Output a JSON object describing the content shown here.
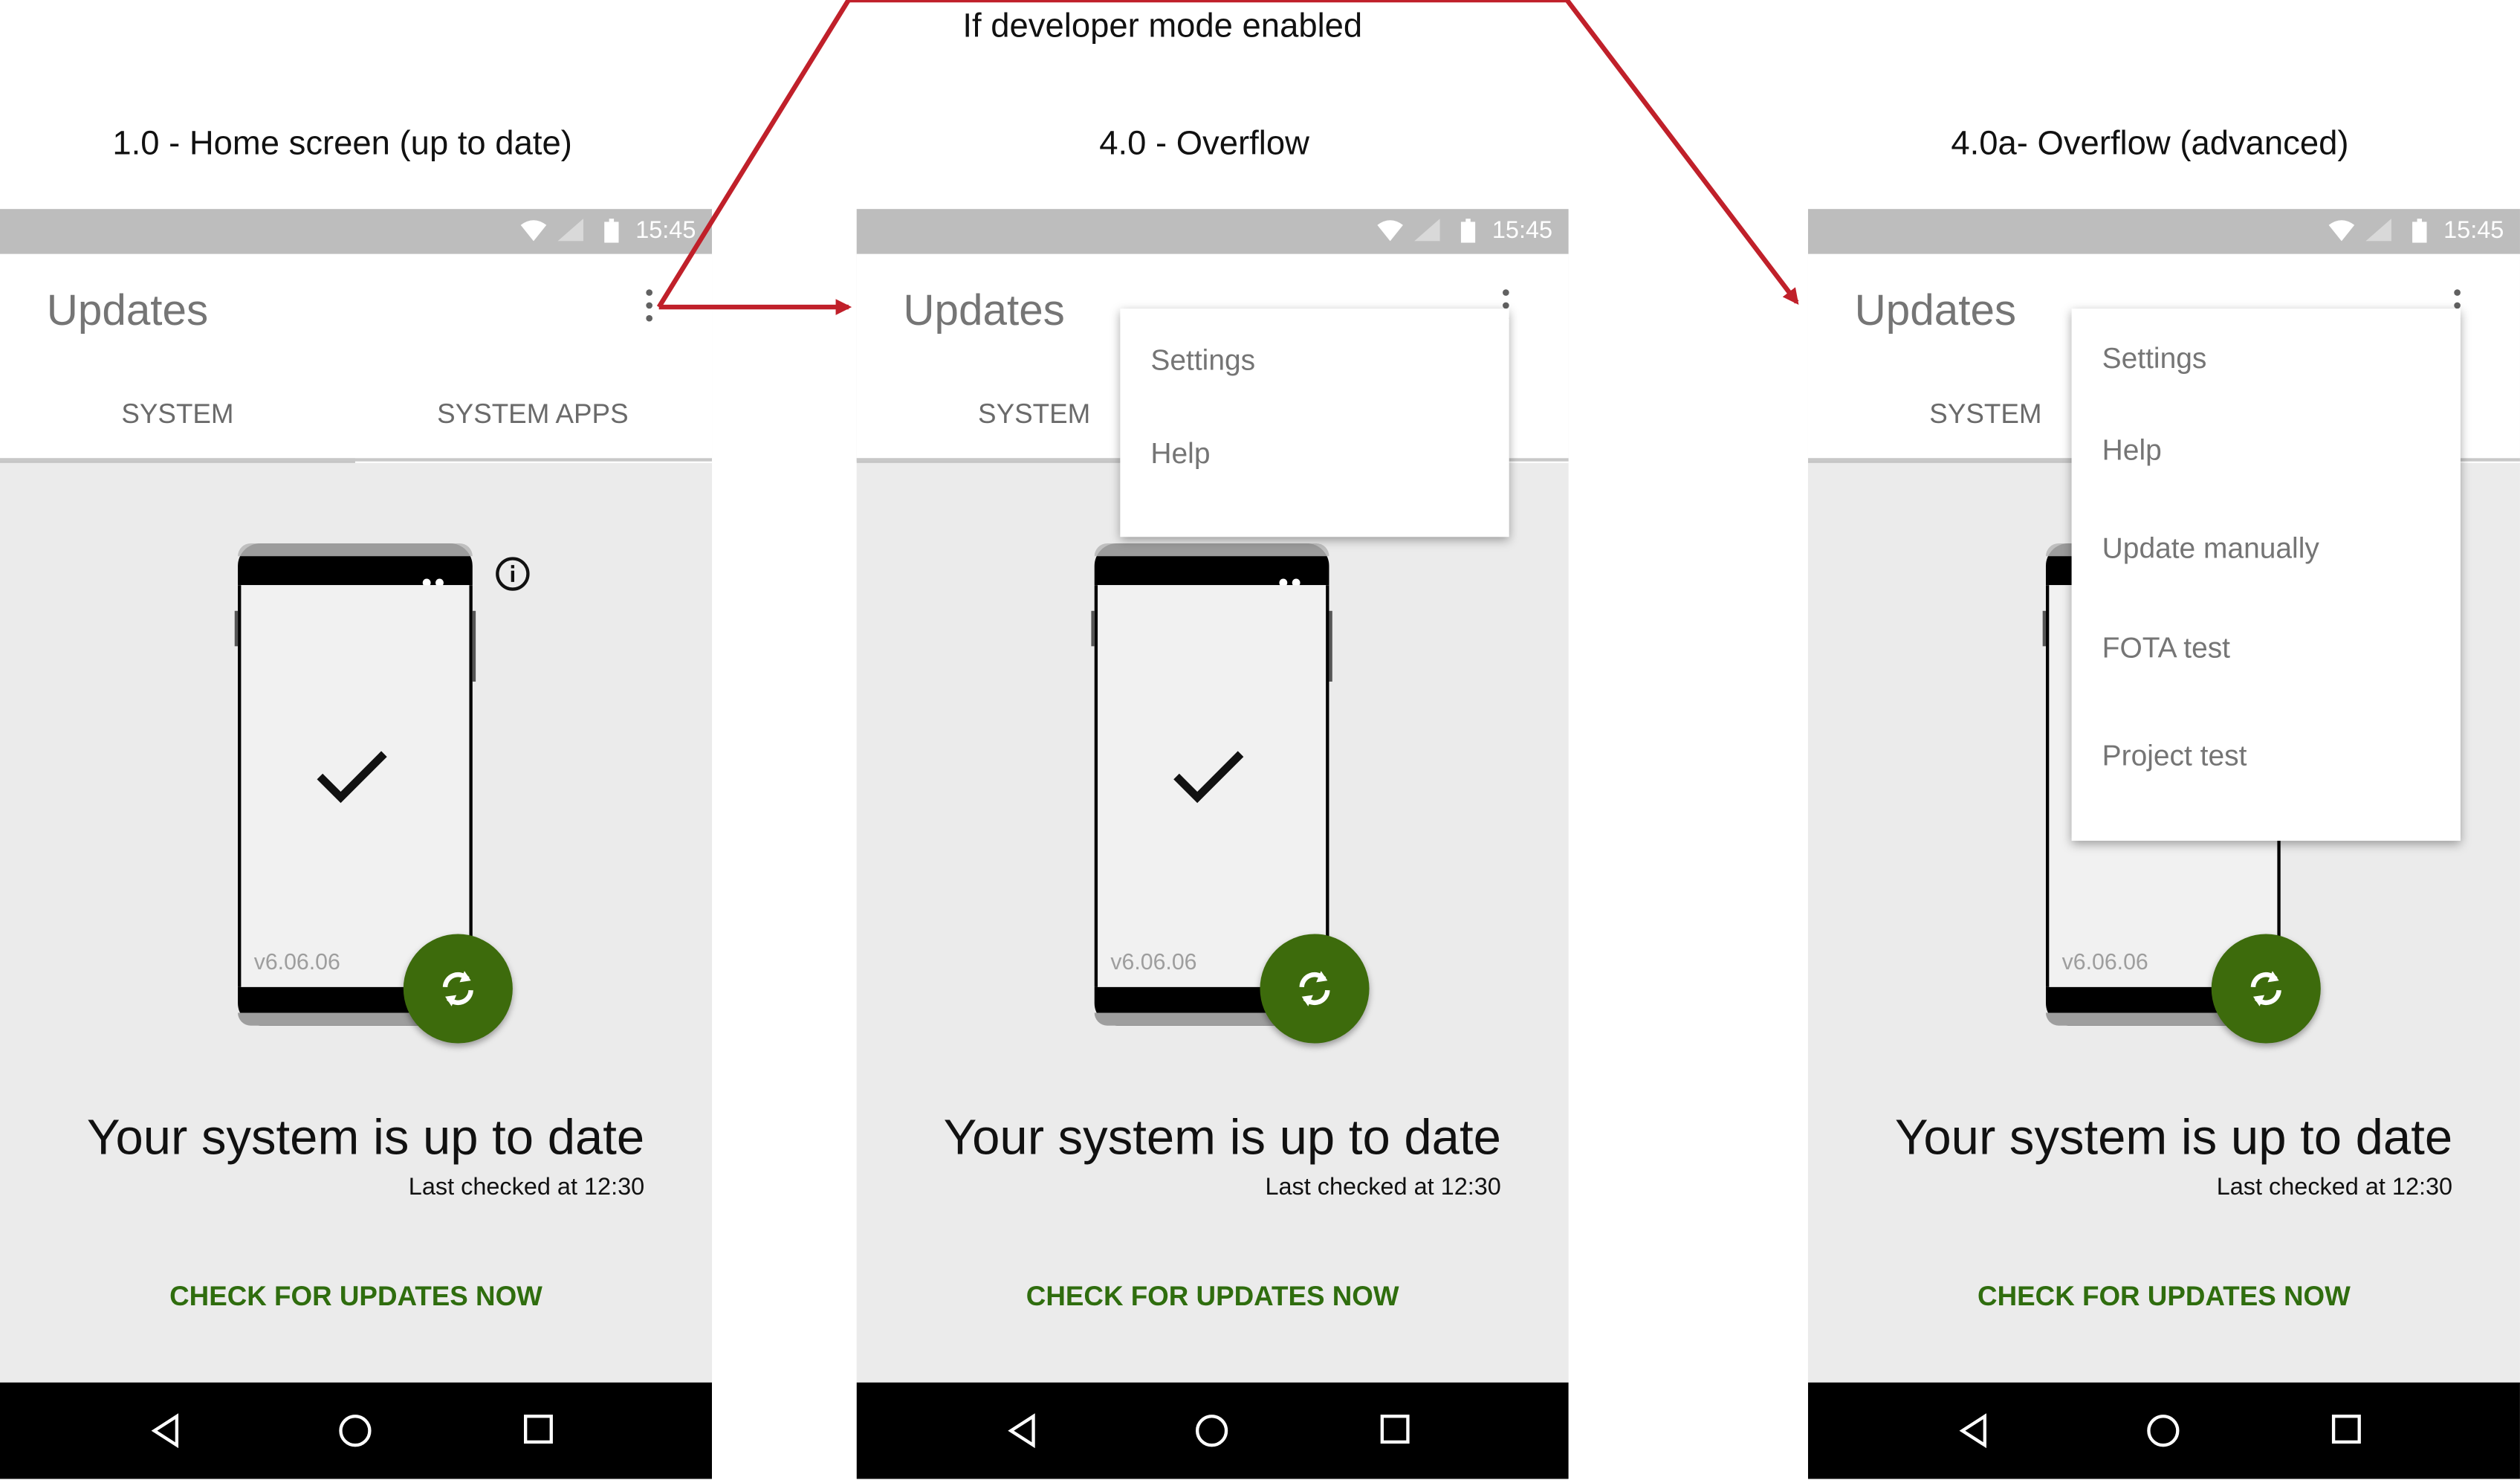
{
  "annotation": "If developer mode enabled",
  "colors": {
    "accent": "#2f6d0e",
    "fab": "#3d6b0c",
    "arrow": "#c0202a",
    "statusbar": "#bdbdbd",
    "background": "#ebebeb"
  },
  "screens": [
    {
      "title": "1.0 - Home screen (up to date)",
      "status_time": "15:45",
      "app_title": "Updates",
      "tabs": [
        "SYSTEM",
        "SYSTEM APPS"
      ],
      "version": "v6.06.06",
      "status_text": "Your system is up to date",
      "last_checked": "Last checked at 12:30",
      "check_button": "CHECK FOR UPDATES NOW"
    },
    {
      "title": "4.0 - Overflow",
      "status_time": "15:45",
      "app_title": "Updates",
      "tabs": [
        "SYSTEM"
      ],
      "version": "v6.06.06",
      "status_text": "Your system is up to date",
      "last_checked": "Last checked at 12:30",
      "check_button": "CHECK FOR UPDATES NOW",
      "menu": [
        "Settings",
        "Help"
      ]
    },
    {
      "title": "4.0a- Overflow (advanced)",
      "status_time": "15:45",
      "app_title": "Updates",
      "tabs": [
        "SYSTEM"
      ],
      "version": "v6.06.06",
      "status_text": "Your system is up to date",
      "last_checked": "Last checked at 12:30",
      "check_button": "CHECK FOR UPDATES NOW",
      "menu": [
        "Settings",
        "Help",
        "Update manually",
        "FOTA test",
        "Project test"
      ]
    }
  ],
  "icons": {
    "status": [
      "wifi-icon",
      "signal-icon",
      "battery-icon"
    ],
    "navigation": [
      "back-icon",
      "home-icon",
      "recents-icon"
    ],
    "overflow": "more-vert-icon",
    "fab": "sync-icon",
    "info": "info-icon",
    "check": "checkmark-icon"
  }
}
